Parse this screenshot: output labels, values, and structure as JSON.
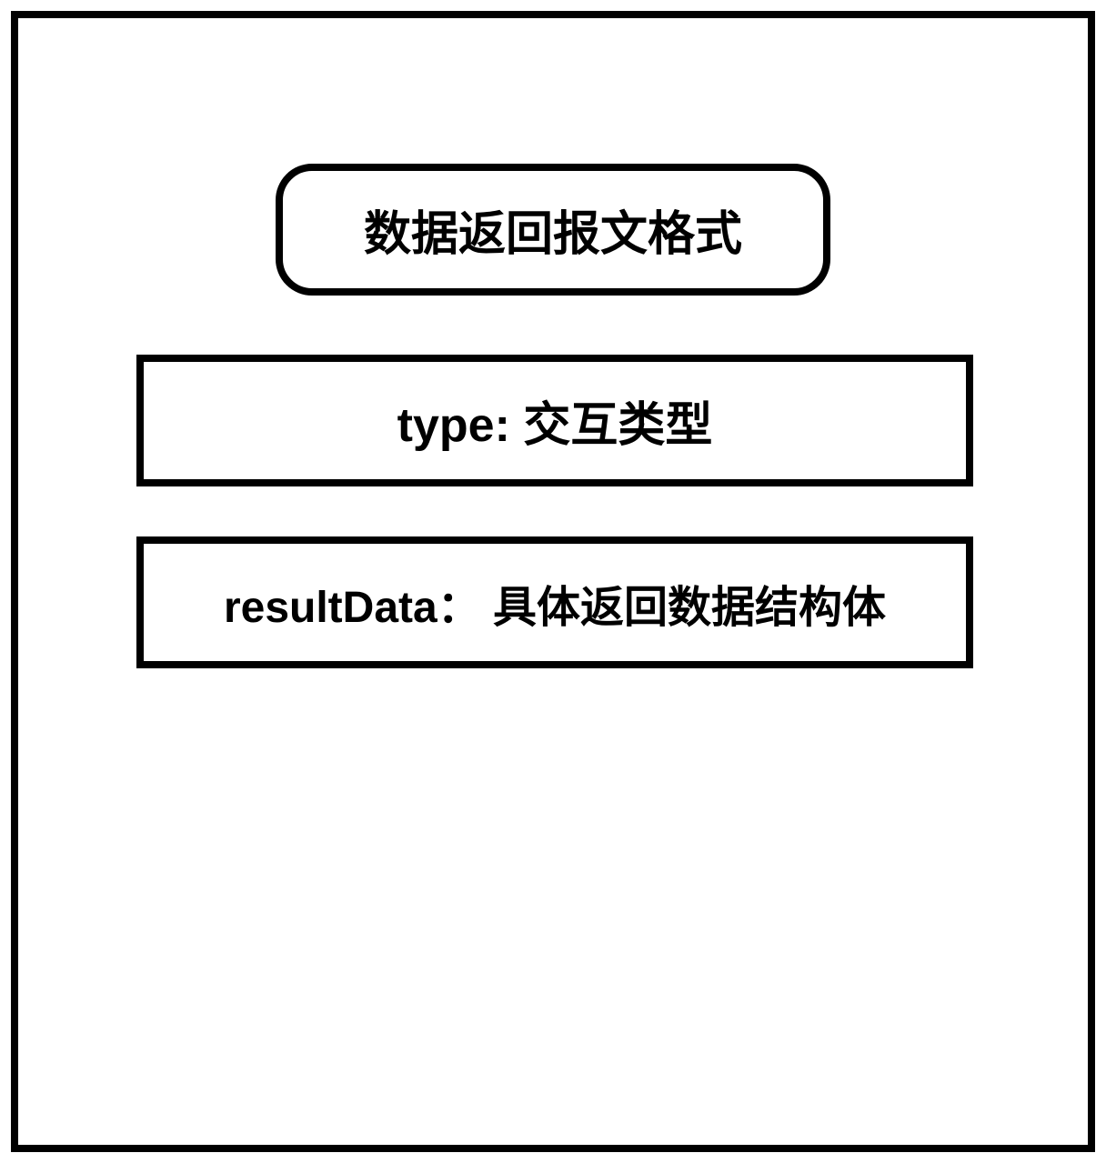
{
  "diagram": {
    "title": "数据返回报文格式",
    "fields": [
      {
        "name": "type",
        "description": "交互类型",
        "label": "type:  交互类型"
      },
      {
        "name": "resultData",
        "description": "具体返回数据结构体",
        "label": "resultData： 具体返回数据结构体"
      }
    ]
  }
}
